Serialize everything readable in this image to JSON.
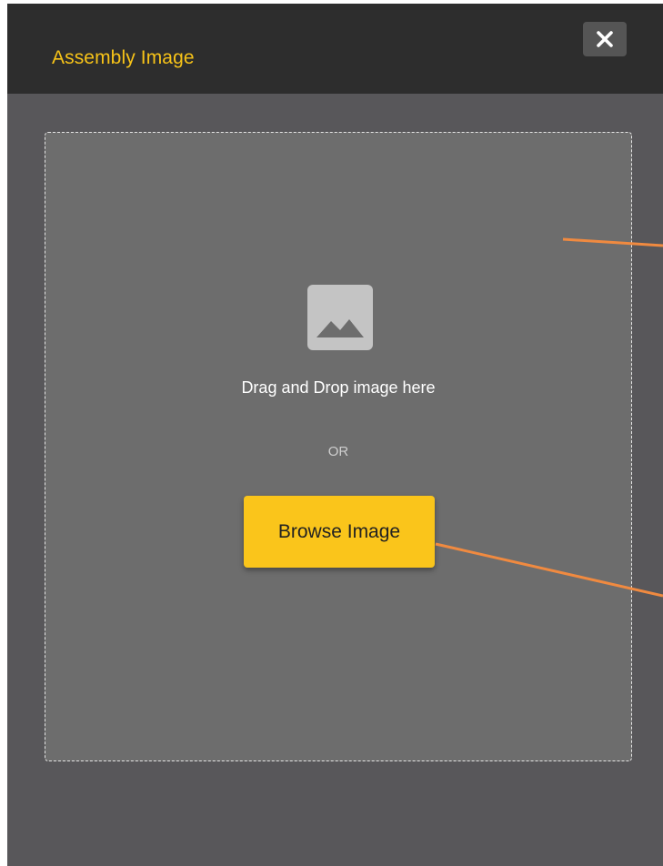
{
  "dialog": {
    "title": "Assembly Image",
    "close_icon": "close-icon"
  },
  "dropzone": {
    "icon": "image-icon",
    "drop_label": "Drag and Drop image here",
    "or_label": "OR",
    "browse_label": "Browse Image"
  },
  "colors": {
    "accent": "#f7c318",
    "button": "#fac51b",
    "header_bg": "#2d2d2d",
    "body_bg": "#58575a",
    "dropzone_bg": "#6d6d6d",
    "annotation_line": "#f08a40"
  }
}
